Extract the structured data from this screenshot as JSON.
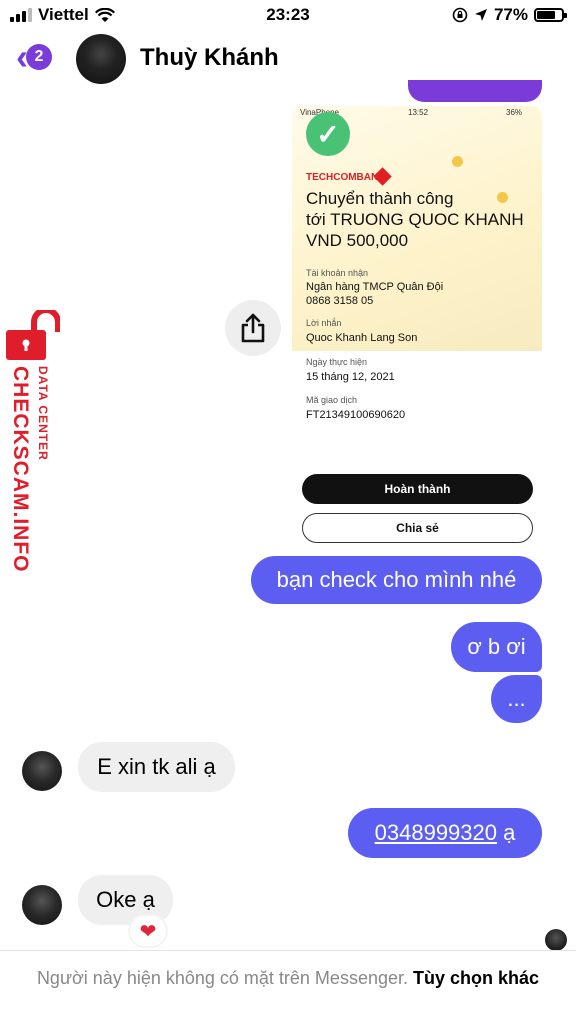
{
  "status_bar": {
    "carrier": "Viettel",
    "time": "23:23",
    "battery_percent": "77%",
    "battery_level": 0.77
  },
  "header": {
    "back_badge": "2",
    "contact_name": "Thuỳ Khánh"
  },
  "receipt": {
    "status_carrier": "VinaPhone",
    "status_time": "13:52",
    "status_battery": "36%",
    "bank_name": "TECHCOMBANK",
    "title_line1": "Chuyển thành công",
    "title_line2": "tới TRUONG QUOC KHANH",
    "title_line3": "VND 500,000",
    "recipient_account_label": "Tài khoản nhận",
    "recipient_bank": "Ngân hàng TMCP Quân Đội",
    "recipient_account": "0868 3158 05",
    "message_label": "Lời nhắn",
    "message_value": "Quoc Khanh Lang Son",
    "date_label": "Ngày thực hiện",
    "date_value": "15 tháng 12, 2021",
    "transaction_label": "Mã giao dịch",
    "transaction_value": "FT21349100690620",
    "done_button": "Hoàn thành",
    "share_button": "Chia sẻ"
  },
  "messages": {
    "out1": "bạn check cho mình nhé",
    "out2": "ơ b ơi",
    "out3": "...",
    "in1": "E xin tk ali ạ",
    "out4_link": "0348999320",
    "out4_suffix": " ạ",
    "in2": "Oke ạ",
    "in2_reaction": "❤"
  },
  "footer": {
    "muted_text": "Người này hiện không có mặt trên Messenger.",
    "action_text": "Tùy chọn khác"
  },
  "watermark": {
    "main": "CHECKSCAM.INFO",
    "sub": "DATA CENTER"
  },
  "colors": {
    "accent": "#7b3bd9",
    "outgoing_bubble": "#5b5ef0",
    "incoming_bubble": "#efefef",
    "watermark_red": "#e01d2a"
  },
  "icons": [
    "back-chevron-icon",
    "share-icon",
    "check-icon",
    "wifi-icon",
    "signal-icon",
    "location-icon",
    "lock-rotation-icon",
    "heart-icon",
    "lock-icon"
  ]
}
